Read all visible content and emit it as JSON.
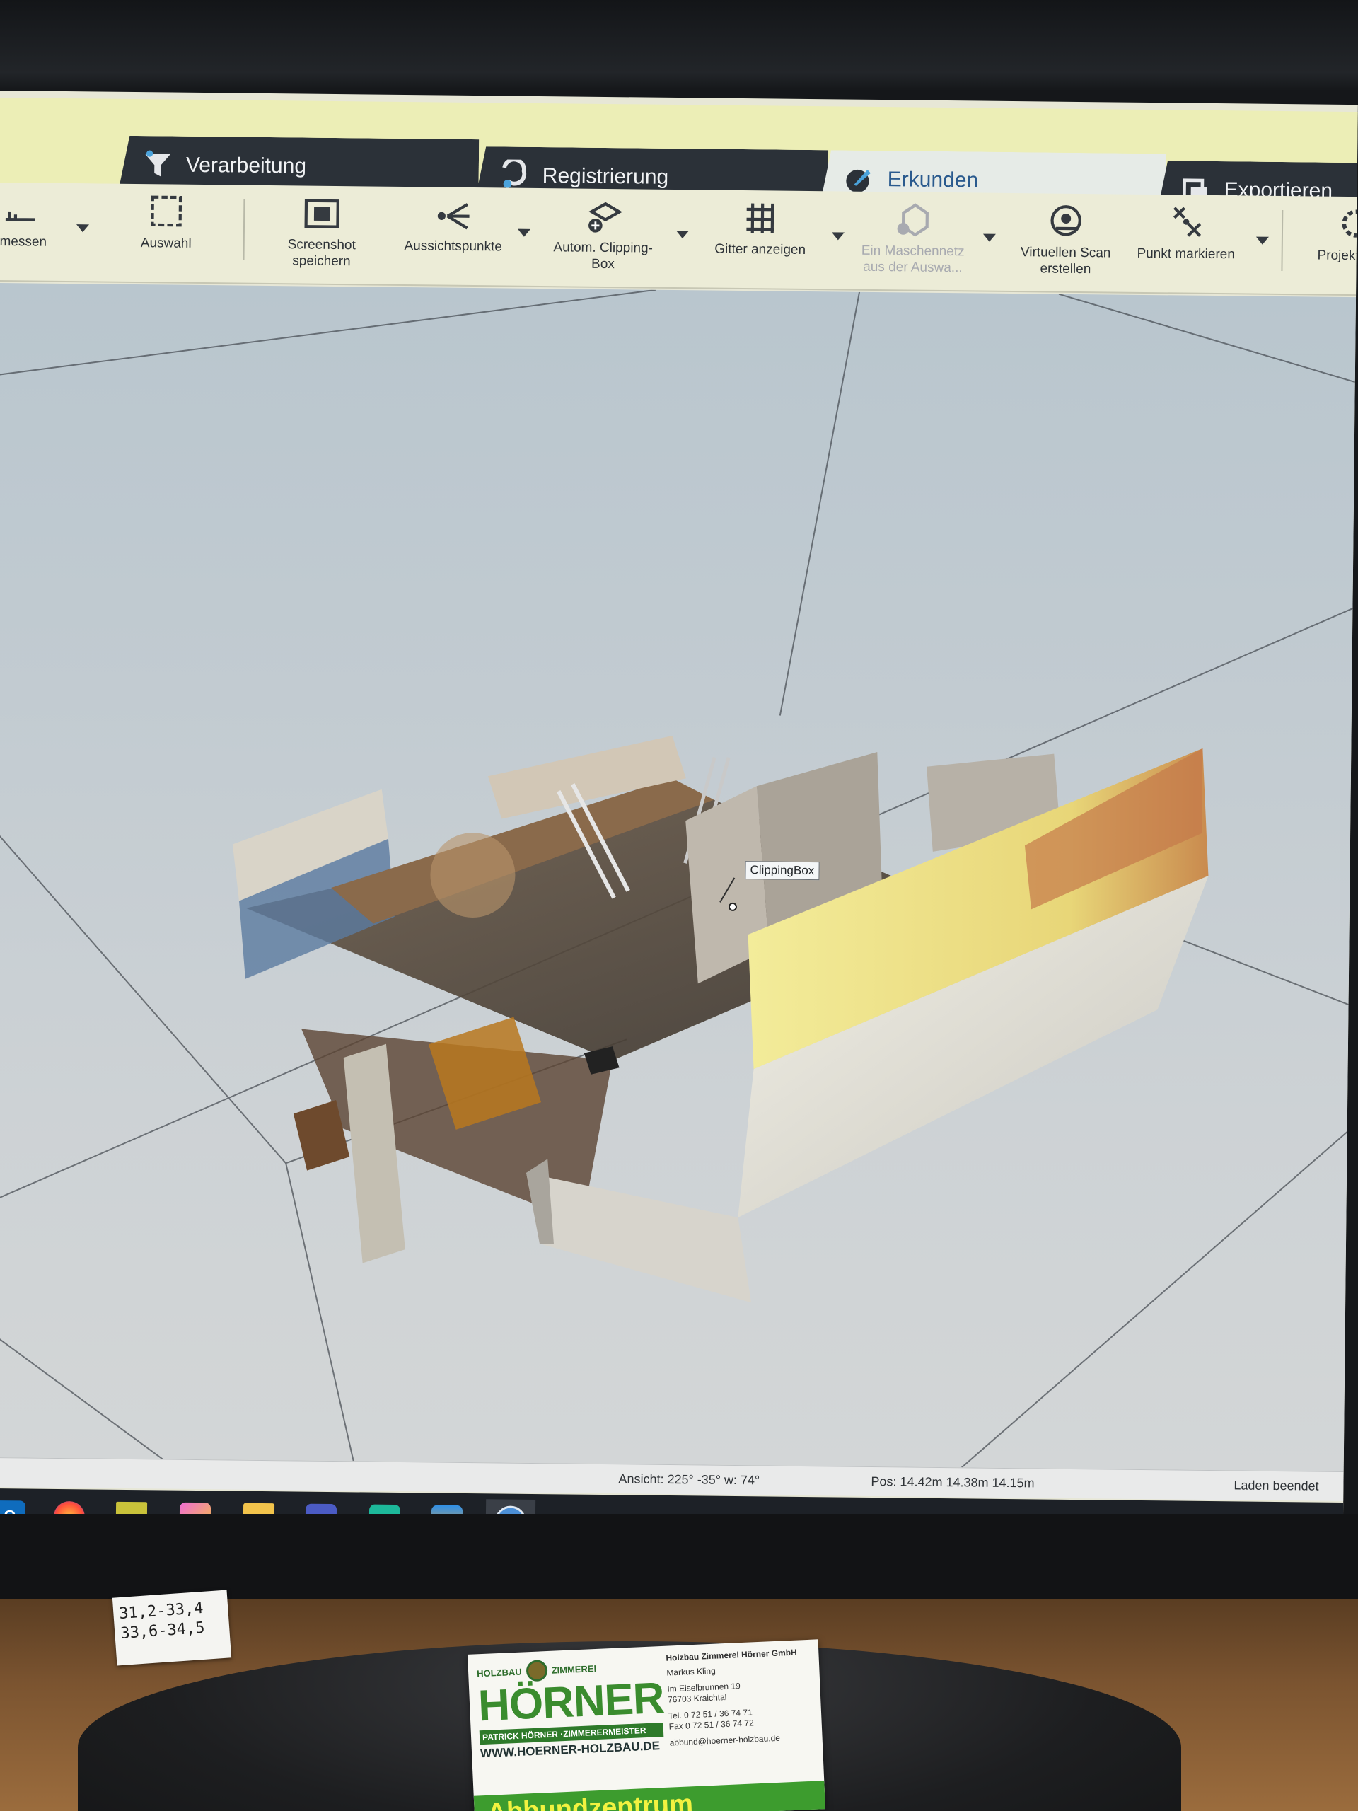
{
  "tabs": [
    {
      "label": "Verarbeitung",
      "icon": "funnel-icon"
    },
    {
      "label": "Registrierung",
      "icon": "registration-icon"
    },
    {
      "label": "Erkunden",
      "icon": "explore-icon",
      "active": true
    },
    {
      "label": "Exportieren",
      "icon": "export-icon"
    }
  ],
  "ribbon": {
    "messen": "messen",
    "auswahl": "Auswahl",
    "screenshot": "Screenshot speichern",
    "aussichtspunkte": "Aussichtspunkte",
    "clipping": "Autom. Clipping-Box",
    "gitter": "Gitter anzeigen",
    "maschennetz": "Ein Maschennetz aus der Auswa...",
    "virtuellen_scan": "Virtuellen Scan erstellen",
    "punkt_markieren": "Punkt markieren",
    "projekt": "Projektpu"
  },
  "viewport": {
    "clipping_label": "ClippingBox"
  },
  "status": {
    "ansicht": "Ansicht: 225° -35° w: 74°",
    "pos": "Pos: 14.42m 14.38m 14.15m",
    "laden": "Laden beendet"
  },
  "taskbar": {
    "apps": [
      "outlook",
      "firefox",
      "app-yellow",
      "paint",
      "file-explorer",
      "teams",
      "app-teal",
      "store",
      "scene"
    ],
    "active": "scene"
  },
  "sticky_note": {
    "line1": "31,2-33,4",
    "line2": "33,6-34,5"
  },
  "business_card": {
    "tag_left": "HOLZBAU",
    "tag_right": "ZIMMEREI",
    "brand": "HÖRNER",
    "sub": "PATRICK HÖRNER ·ZIMMERERMEISTER",
    "web": "WWW.HOERNER-HOLZBAU.DE",
    "company": "Holzbau Zimmerei Hörner GmbH",
    "person": "Markus Kling",
    "street": "Im Eiselbrunnen 19",
    "city": "76703 Kraichtal",
    "tel": "Tel. 0 72 51 / 36 74 71",
    "fax": "Fax 0 72 51 / 36 74 72",
    "email": "abbund@hoerner-holzbau.de",
    "banner": "Abbundzentrum"
  },
  "colors": {
    "tab_dark": "#2b3138",
    "accent_blue": "#2a5a8e",
    "ribbon_bg": "#ececd7",
    "brand_green": "#3a8c2e"
  }
}
